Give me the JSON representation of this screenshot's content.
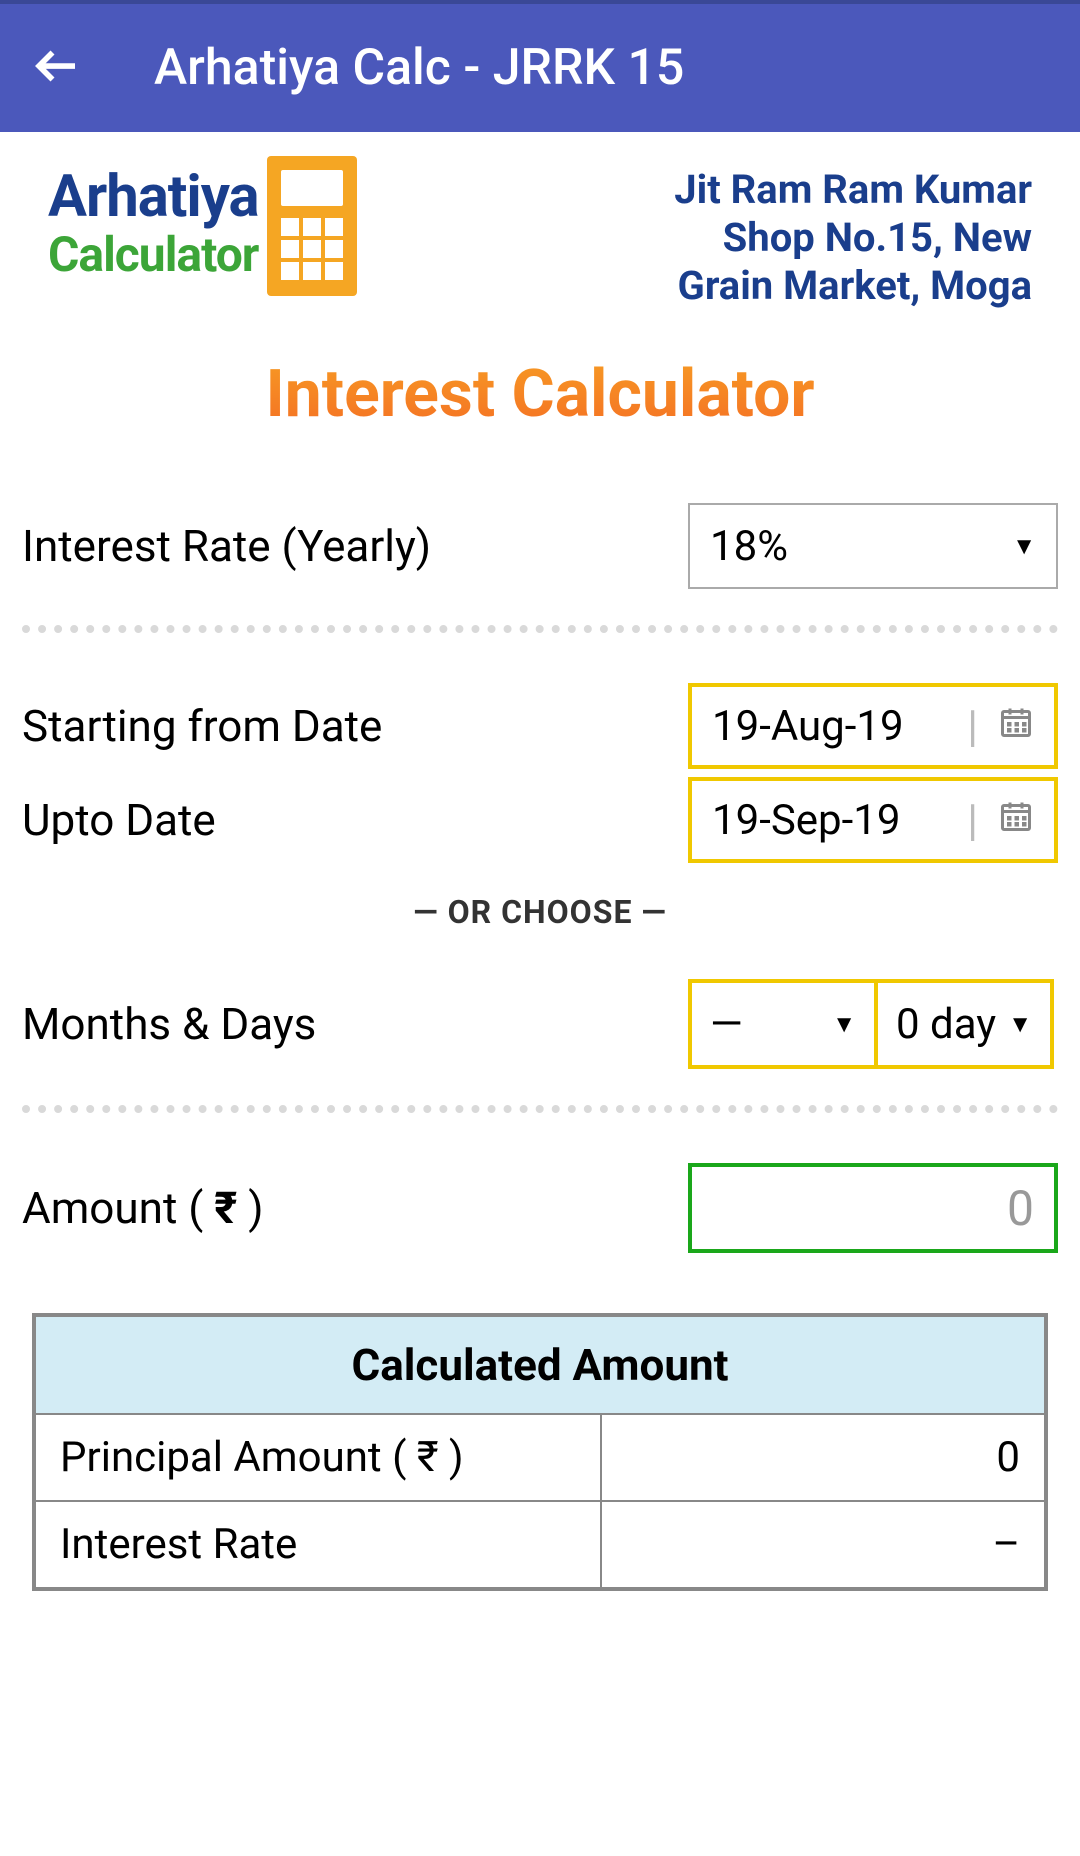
{
  "header": {
    "title": "Arhatiya Calc - JRRK 15"
  },
  "logo": {
    "word1": "Arhatiya",
    "word2": "Calculator"
  },
  "shop": {
    "line1": "Jit Ram Ram Kumar",
    "line2": "Shop No.15, New",
    "line3": "Grain Market, Moga"
  },
  "main_title": "Interest Calculator",
  "form": {
    "rate_label": "Interest Rate (Yearly)",
    "rate_value": "18%",
    "start_date_label": "Starting from Date",
    "start_date_value": "19-Aug-19",
    "upto_date_label": "Upto Date",
    "upto_date_value": "19-Sep-19",
    "or_choose": "— OR CHOOSE —",
    "months_days_label": "Months & Days",
    "months_value": "—",
    "days_value": "0 day",
    "amount_label_prefix": "Amount ( ",
    "amount_label_suffix": " )",
    "amount_value": "0"
  },
  "results": {
    "title": "Calculated Amount",
    "rows": [
      {
        "label": "Principal Amount ( ₹ )",
        "value": "0"
      },
      {
        "label": "Interest Rate",
        "value": "–"
      }
    ]
  }
}
